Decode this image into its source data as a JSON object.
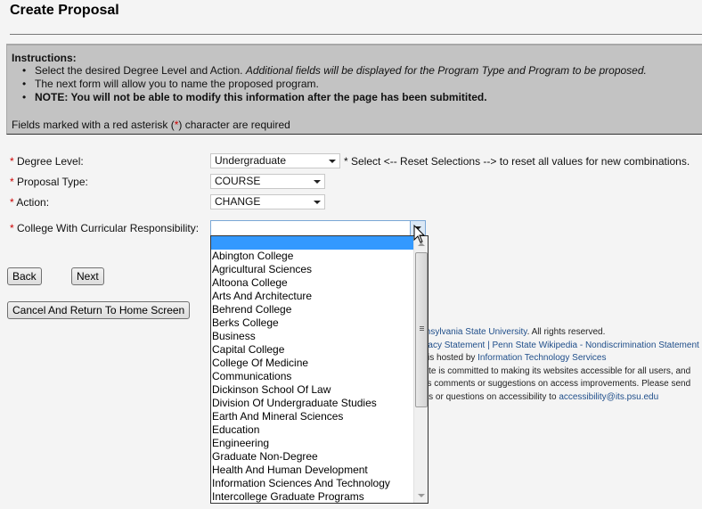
{
  "page": {
    "title": "Create Proposal"
  },
  "instructions": {
    "heading": "Instructions:",
    "items": [
      {
        "normal": "Select the desired Degree Level and Action. ",
        "italic": "Additional fields will be displayed for the Program Type and Program to be proposed."
      },
      {
        "normal": "The next form will allow you to name the proposed program."
      },
      {
        "bold": "NOTE: You will not be able to modify this information after the page has been submitited."
      }
    ],
    "required_note_prefix": "Fields marked with a red asterisk (",
    "required_note_asterisk": "*",
    "required_note_suffix": ") character are required"
  },
  "form": {
    "required_marker": "*",
    "degree_level": {
      "label": " Degree Level:",
      "value": "Undergraduate"
    },
    "proposal_type": {
      "label": " Proposal Type:",
      "value": "COURSE"
    },
    "action": {
      "label": " Action:",
      "value": "CHANGE"
    },
    "college": {
      "label": " College With Curricular Responsibility:",
      "value": ""
    },
    "hint": "* Select <-- Reset Selections --> to reset all values for new combinations."
  },
  "buttons": {
    "back": "Back",
    "next": "Next",
    "cancel": "Cancel And Return To Home Screen"
  },
  "dropdown": {
    "options": [
      "",
      "Abington College",
      "Agricultural Sciences",
      "Altoona College",
      "Arts And Architecture",
      "Behrend College",
      "Berks College",
      "Business",
      "Capital College",
      "College Of Medicine",
      "Communications",
      "Dickinson School Of Law",
      "Division Of Undergraduate Studies",
      "Earth And Mineral Sciences",
      "Education",
      "Engineering",
      "Graduate Non-Degree",
      "Health And Human Development",
      "Information Sciences And Technology",
      "Intercollege Graduate Programs"
    ],
    "highlighted_index": 0
  },
  "footer": {
    "line1_link": "The Pennsylvania State University",
    "line1_text": ". All rights reserved.",
    "line2_link": "Web Privacy Statement | Penn State Wikipedia - Nondiscrimination Statement",
    "line3_text": "This site is hosted by ",
    "line3_link": "Information Technology Services",
    "line4_text": "Penn State is committed to making its websites accessible for all users, and",
    "line5_text": "welcomes comments or suggestions on access improvements. Please send",
    "line6_text": "comments or questions on accessibility to ",
    "line6_link": "accessibility@its.psu.edu"
  }
}
